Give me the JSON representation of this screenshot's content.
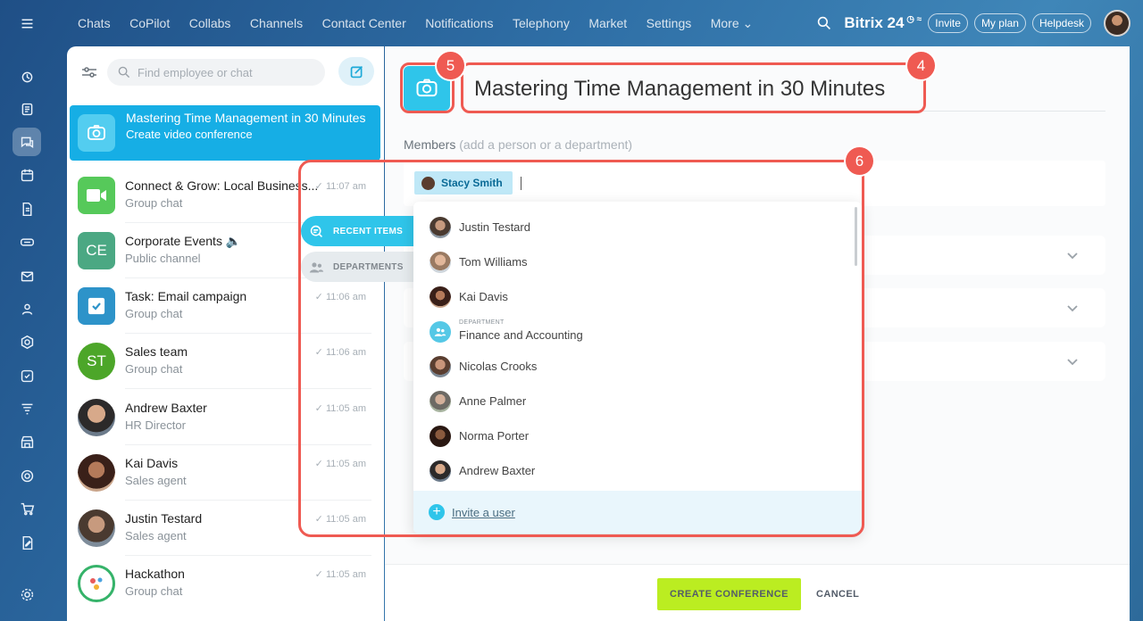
{
  "topbar": {
    "nav": [
      "Chats",
      "CoPilot",
      "Collabs",
      "Channels",
      "Contact Center",
      "Notifications",
      "Telephony",
      "Market",
      "Settings",
      "More ⌄"
    ],
    "brand": "Bitrix 24",
    "invite": "Invite",
    "my_plan": "My plan",
    "helpdesk": "Helpdesk"
  },
  "search": {
    "placeholder": "Find employee or chat"
  },
  "chats": [
    {
      "title": "Mastering Time Management in 30 Minutes",
      "sub": "Create video conference",
      "time": "",
      "ava": "camera",
      "color": "#2fc5ea"
    },
    {
      "title": "Connect & Grow: Local Business...",
      "sub": "Group chat",
      "time": "✓ 11:07 am",
      "ava": "video",
      "color": "#56c95a"
    },
    {
      "title": "Corporate Events 🔈",
      "sub": "Public channel",
      "time": "",
      "ava": "CE",
      "color": "#4ba883"
    },
    {
      "title": "Task: Email campaign",
      "sub": "Group chat",
      "time": "✓ 11:06 am",
      "ava": "task",
      "color": "#2d93c9"
    },
    {
      "title": "Sales team",
      "sub": "Group chat",
      "time": "✓ 11:06 am",
      "ava": "ST",
      "color": "#4ca629"
    },
    {
      "title": "Andrew Baxter",
      "sub": "HR Director",
      "time": "✓ 11:05 am",
      "ava": "photo",
      "color": "#7b6a5d"
    },
    {
      "title": "Kai Davis",
      "sub": "Sales agent",
      "time": "✓ 11:05 am",
      "ava": "photo",
      "color": "#5b3b30"
    },
    {
      "title": "Justin Testard",
      "sub": "Sales agent",
      "time": "✓ 11:05 am",
      "ava": "photo",
      "color": "#6a5548"
    },
    {
      "title": "Hackathon",
      "sub": "Group chat",
      "time": "✓ 11:05 am",
      "ava": "hack",
      "color": "#36b36a"
    }
  ],
  "conference": {
    "title": "Mastering Time Management in 30 Minutes",
    "members_label": "Members",
    "members_hint": "(add a person or a department)",
    "chip": "Stacy Smith"
  },
  "tabs": {
    "recent": "RECENT ITEMS",
    "departments": "DEPARTMENTS"
  },
  "popup": {
    "items": [
      {
        "name": "Justin Testard",
        "type": "user",
        "color": "#7a6656"
      },
      {
        "name": "Tom Williams",
        "type": "user",
        "color": "#b98f72"
      },
      {
        "name": "Kai Davis",
        "type": "user",
        "color": "#4d3027"
      },
      {
        "name": "Finance and Accounting",
        "type": "department",
        "label": "DEPARTMENT",
        "color": "#55c8e6"
      },
      {
        "name": "Nicolas Crooks",
        "type": "user",
        "color": "#8d6b58"
      },
      {
        "name": "Anne Palmer",
        "type": "user",
        "color": "#6d6a64"
      },
      {
        "name": "Norma Porter",
        "type": "user",
        "color": "#3b261d"
      },
      {
        "name": "Andrew Baxter",
        "type": "user",
        "color": "#5a4b42"
      }
    ],
    "invite": "Invite a user"
  },
  "footer": {
    "create": "CREATE CONFERENCE",
    "cancel": "CANCEL"
  },
  "badges": {
    "b4": "4",
    "b5": "5",
    "b6": "6"
  }
}
